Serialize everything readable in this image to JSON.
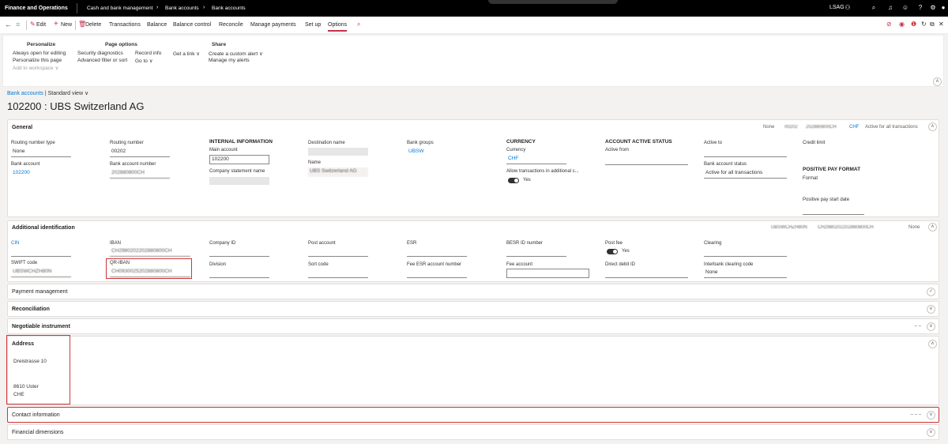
{
  "nav": {
    "app_title": "Finance and Operations",
    "breadcrumb": [
      "Cash and bank management",
      "Bank accounts",
      "Bank accounts"
    ],
    "company": "LSAG"
  },
  "actions": {
    "edit": "Edit",
    "new": "New",
    "delete": "Delete",
    "transactions": "Transactions",
    "balance": "Balance",
    "balance_control": "Balance control",
    "reconcile": "Reconcile",
    "manage_payments": "Manage payments",
    "set_up": "Set up",
    "options": "Options"
  },
  "ribbon": {
    "personalize": {
      "title": "Personalize",
      "items": [
        "Always open for editing",
        "Personalize this page",
        "Add to workspace"
      ]
    },
    "page_options": {
      "title": "Page options",
      "items": [
        "Security diagnostics",
        "Advanced filter or sort",
        "Record info",
        "Go to",
        "Get a link"
      ]
    },
    "share": {
      "title": "Share",
      "items": [
        "Create a custom alert",
        "Manage my alerts"
      ]
    }
  },
  "page": {
    "breadcrumb_link": "Bank accounts",
    "view": "Standard view",
    "title": "102200 : UBS Switzerland AG"
  },
  "general": {
    "title": "General",
    "summary": [
      "None",
      "00202",
      "202880800CH",
      "CHF",
      "Active for all transactions"
    ],
    "routing_number_type_label": "Routing number type",
    "routing_number_type": "None",
    "routing_number_label": "Routing number",
    "routing_number": "00202",
    "bank_account_label": "Bank account",
    "bank_account": "102200",
    "bank_account_number_label": "Bank account number",
    "bank_account_number": "202880800CH",
    "internal_info": "INTERNAL INFORMATION",
    "main_account_label": "Main account",
    "main_account": "102200",
    "company_statement_label": "Company statement name",
    "destination_name_label": "Destination name",
    "name_label": "Name",
    "name": "UBS Switzerland AG",
    "bank_groups_label": "Bank groups",
    "bank_groups": "UBSW",
    "currency_head": "CURRENCY",
    "currency_label": "Currency",
    "currency": "CHF",
    "allow_tx_label": "Allow transactions in additional c...",
    "allow_tx": "Yes",
    "account_active_head": "ACCOUNT ACTIVE STATUS",
    "active_from_label": "Active from",
    "active_to_label": "Active to",
    "bank_account_status_label": "Bank account status",
    "bank_account_status": "Active for all transactions",
    "credit_limit_label": "Credit limit",
    "positive_pay_head": "POSITIVE PAY FORMAT",
    "format_label": "Format",
    "positive_pay_start_label": "Positive pay start date"
  },
  "additional": {
    "title": "Additional identification",
    "summary": [
      "UBSWCHZH80N",
      "CH2980202202880800CH",
      "None"
    ],
    "cin_label": "CIN",
    "iban_label": "IBAN",
    "iban": "CH2980202202880800CH",
    "company_id_label": "Company ID",
    "post_account_label": "Post account",
    "esr_label": "ESR",
    "besr_label": "BESR ID number",
    "post_fee_label": "Post fee",
    "post_fee": "Yes",
    "clearing_label": "Clearing",
    "swift_label": "SWIFT code",
    "swift": "UBSWCHZH80N",
    "qr_iban_label": "QR-IBAN",
    "qr_iban": "CH0930025202880800CH",
    "division_label": "Division",
    "sort_code_label": "Sort code",
    "fee_esr_label": "Fee ESR account number",
    "fee_account_label": "Fee account",
    "direct_debit_label": "Direct debit ID",
    "interbank_label": "Interbank clearing code",
    "interbank": "None"
  },
  "tabs": {
    "payment_management": "Payment management",
    "reconciliation": "Reconciliation",
    "negotiable_instrument": "Negotiable instrument",
    "address": "Address",
    "contact_information": "Contact information",
    "financial_dimensions": "Financial dimensions"
  },
  "address": {
    "line1": "Dreistrasse 10",
    "line2": "8610 Uster",
    "line3": "CHE"
  },
  "colors": {
    "accent": "#c4314b",
    "link": "#0078d4",
    "highlight": "#d13438"
  }
}
